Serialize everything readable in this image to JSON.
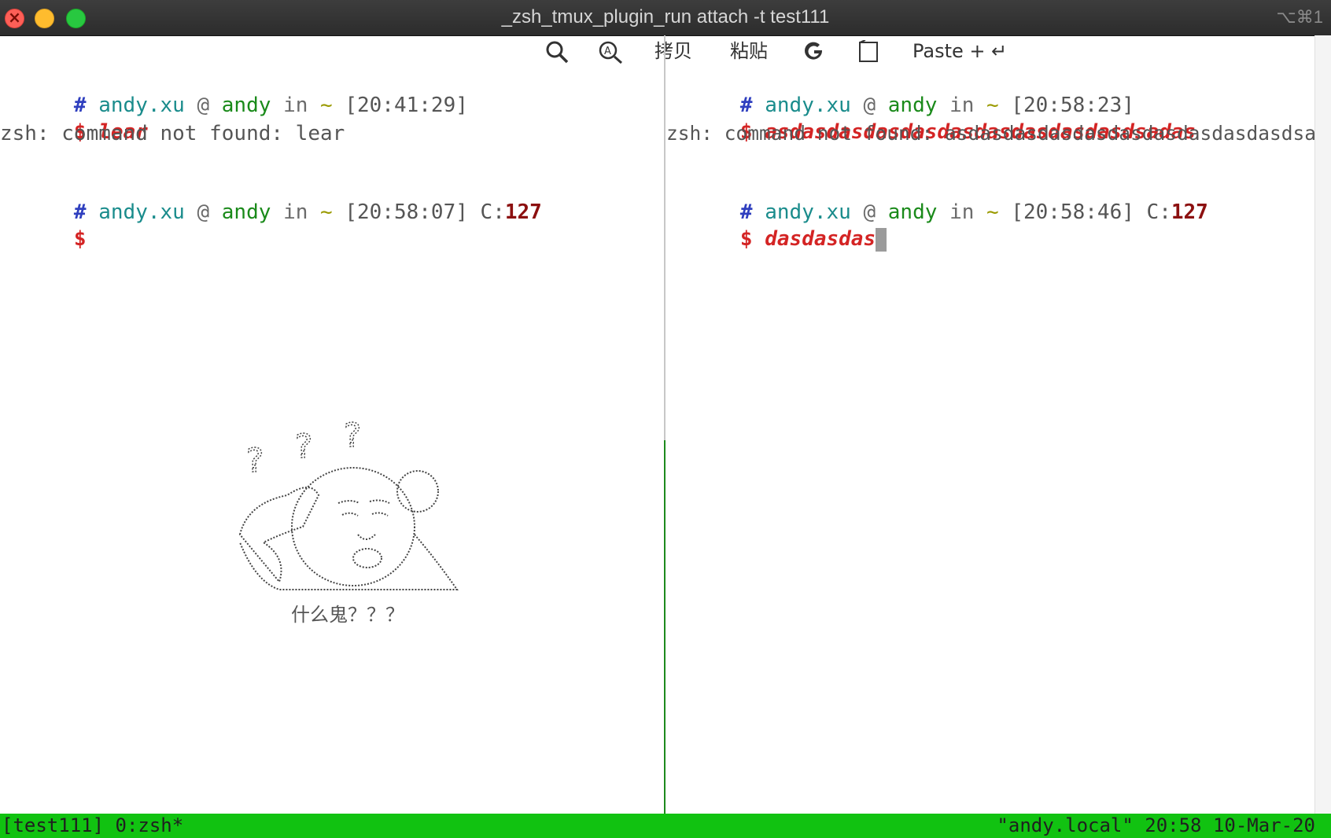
{
  "window": {
    "title": "_zsh_tmux_plugin_run attach -t test111",
    "shortcut": "⌥⌘1"
  },
  "toolbar": {
    "copy_label": "拷贝",
    "paste_label": "粘贴",
    "paste_plus_label": "Paste + ↵",
    "icons": [
      "search-icon",
      "search-text-icon",
      "google-icon",
      "note-icon"
    ]
  },
  "left_pane": {
    "prompt1": {
      "hash": "#",
      "user": "andy.xu",
      "at": "@",
      "host": "andy",
      "in": "in",
      "dir": "~",
      "time": "[20:41:29]"
    },
    "cmd1": {
      "dollar": "$",
      "text": "lear"
    },
    "out1": "zsh: command not found: lear",
    "prompt2": {
      "hash": "#",
      "user": "andy.xu",
      "at": "@",
      "host": "andy",
      "in": "in",
      "dir": "~",
      "time": "[20:58:07]",
      "code_label": "C:",
      "code": "127"
    },
    "cmd2": {
      "dollar": "$",
      "text": ""
    },
    "sticker_caption": "什么鬼？？？"
  },
  "right_pane": {
    "prompt1": {
      "hash": "#",
      "user": "andy.xu",
      "at": "@",
      "host": "andy",
      "in": "in",
      "dir": "~",
      "time": "[20:58:23]"
    },
    "cmd1": {
      "dollar": "$",
      "text": "asdasdasdasdasdasdasdasdasdasdsadas"
    },
    "out1": "zsh: command not found: asdasdasdasdasdasdasdasdasdasdsadas",
    "prompt2": {
      "hash": "#",
      "user": "andy.xu",
      "at": "@",
      "host": "andy",
      "in": "in",
      "dir": "~",
      "time": "[20:58:46]",
      "code_label": "C:",
      "code": "127"
    },
    "cmd2": {
      "dollar": "$",
      "text": "dasdasdas"
    }
  },
  "statusbar": {
    "left": "[test111] 0:zsh*",
    "right": "\"andy.local\" 20:58 10-Mar-20"
  },
  "colors": {
    "statusbar": "#11c211",
    "prompt_hash": "#2f3fbf",
    "user": "#1a8c8c",
    "host": "#1a8a1a",
    "command": "#d42424",
    "exit_code": "#8c1010"
  }
}
